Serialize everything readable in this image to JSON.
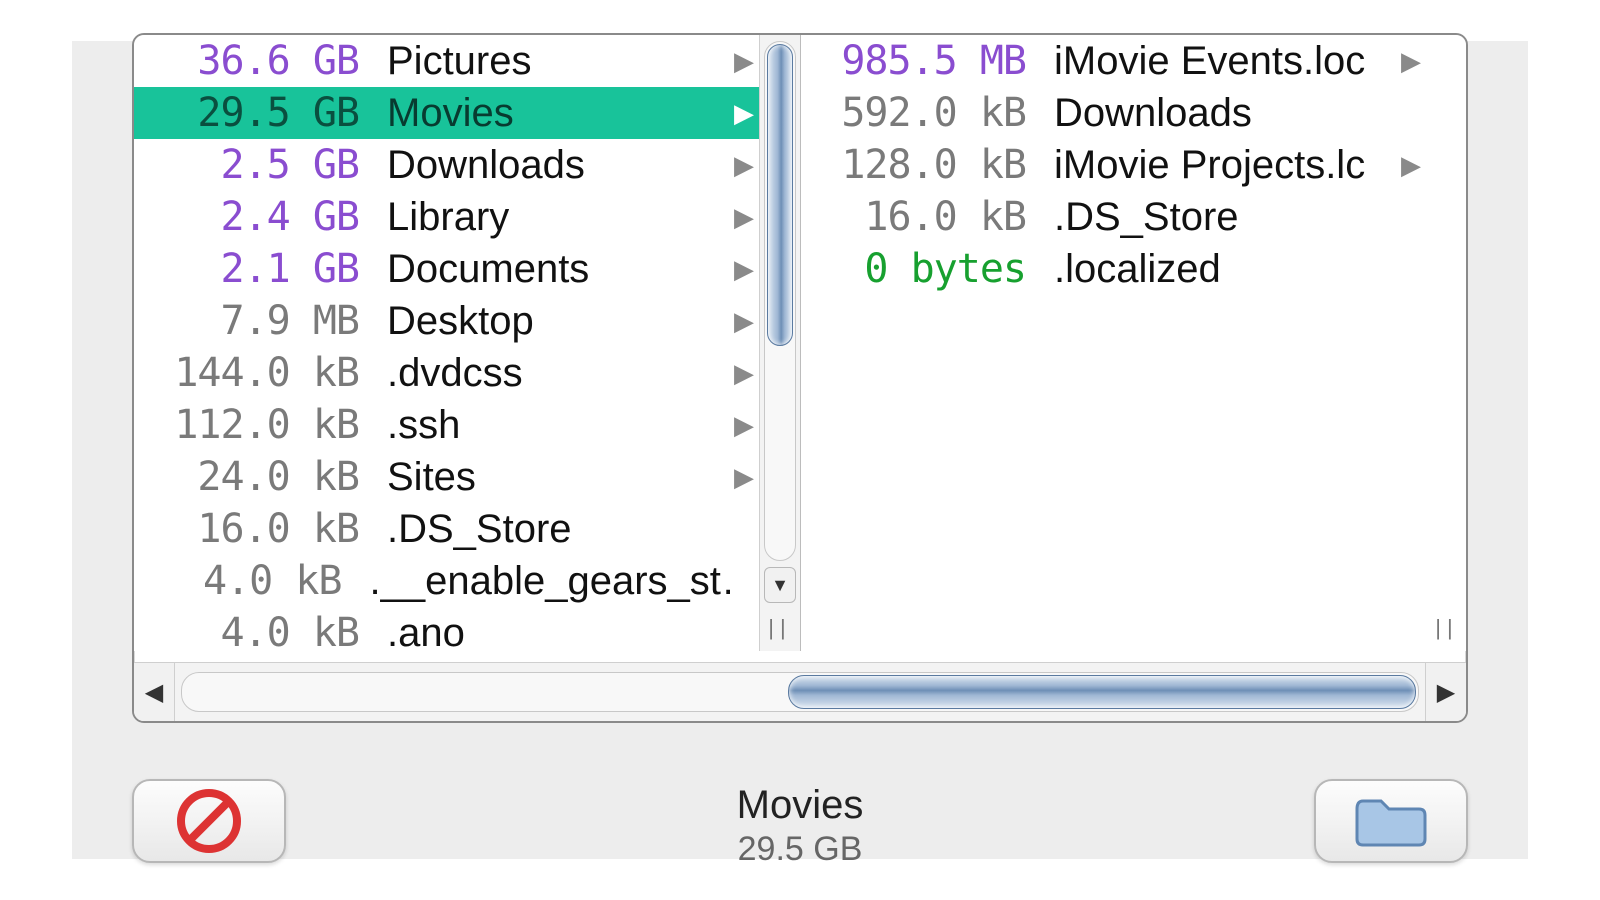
{
  "colors": {
    "selection": "#18c39a",
    "size_gb": "#8a4dd0",
    "size_small": "#7a7a7a",
    "size_zero": "#17a02f"
  },
  "left_column": {
    "selected_index": 1,
    "items": [
      {
        "size": "36.6 GB",
        "name": "Pictures",
        "size_class": "sz-purple",
        "has_children": true
      },
      {
        "size": "29.5 GB",
        "name": "Movies",
        "size_class": "sz-purple",
        "has_children": true
      },
      {
        "size": "2.5 GB",
        "name": "Downloads",
        "size_class": "sz-purple",
        "has_children": true
      },
      {
        "size": "2.4 GB",
        "name": "Library",
        "size_class": "sz-purple",
        "has_children": true
      },
      {
        "size": "2.1 GB",
        "name": "Documents",
        "size_class": "sz-purple",
        "has_children": true
      },
      {
        "size": "7.9 MB",
        "name": "Desktop",
        "size_class": "sz-gray",
        "has_children": true
      },
      {
        "size": "144.0 kB",
        "name": ".dvdcss",
        "size_class": "sz-gray",
        "has_children": true
      },
      {
        "size": "112.0 kB",
        "name": ".ssh",
        "size_class": "sz-gray",
        "has_children": true
      },
      {
        "size": "24.0 kB",
        "name": "Sites",
        "size_class": "sz-gray",
        "has_children": true
      },
      {
        "size": "16.0 kB",
        "name": ".DS_Store",
        "size_class": "sz-gray",
        "has_children": false
      },
      {
        "size": "4.0 kB",
        "name": ".__enable_gears_st…",
        "size_class": "sz-gray",
        "has_children": false
      },
      {
        "size": "4.0 kB",
        "name": ".ano",
        "size_class": "sz-gray",
        "has_children": false
      }
    ]
  },
  "right_column": {
    "items": [
      {
        "size": "985.5 MB",
        "name": "iMovie Events.loc",
        "size_class": "sz-purple",
        "has_children": true
      },
      {
        "size": "592.0 kB",
        "name": "Downloads",
        "size_class": "sz-gray",
        "has_children": false
      },
      {
        "size": "128.0 kB",
        "name": "iMovie Projects.lc",
        "size_class": "sz-gray",
        "has_children": true
      },
      {
        "size": "16.0 kB",
        "name": ".DS_Store",
        "size_class": "sz-gray",
        "has_children": false
      },
      {
        "size": "0 bytes",
        "name": ".localized",
        "size_class": "sz-green",
        "has_children": false
      }
    ]
  },
  "footer": {
    "title": "Movies",
    "subtitle": "29.5 GB"
  }
}
